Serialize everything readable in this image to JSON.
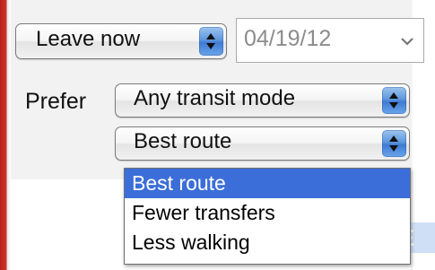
{
  "trip": {
    "leave": {
      "selected": "Leave now"
    },
    "date": {
      "value": "04/19/12"
    }
  },
  "preferences": {
    "label": "Prefer",
    "mode": {
      "selected": "Any transit mode"
    },
    "route": {
      "selected": "Best route",
      "options": [
        "Best route",
        "Fewer transfers",
        "Less walking"
      ],
      "highlighted_index": 0
    }
  },
  "partial_button": {
    "text": "E"
  },
  "colors": {
    "left_edge": "#d03329",
    "selection": "#3b6ed8",
    "stepper": "#4f8ad8",
    "date_text": "#8c8c8c"
  }
}
